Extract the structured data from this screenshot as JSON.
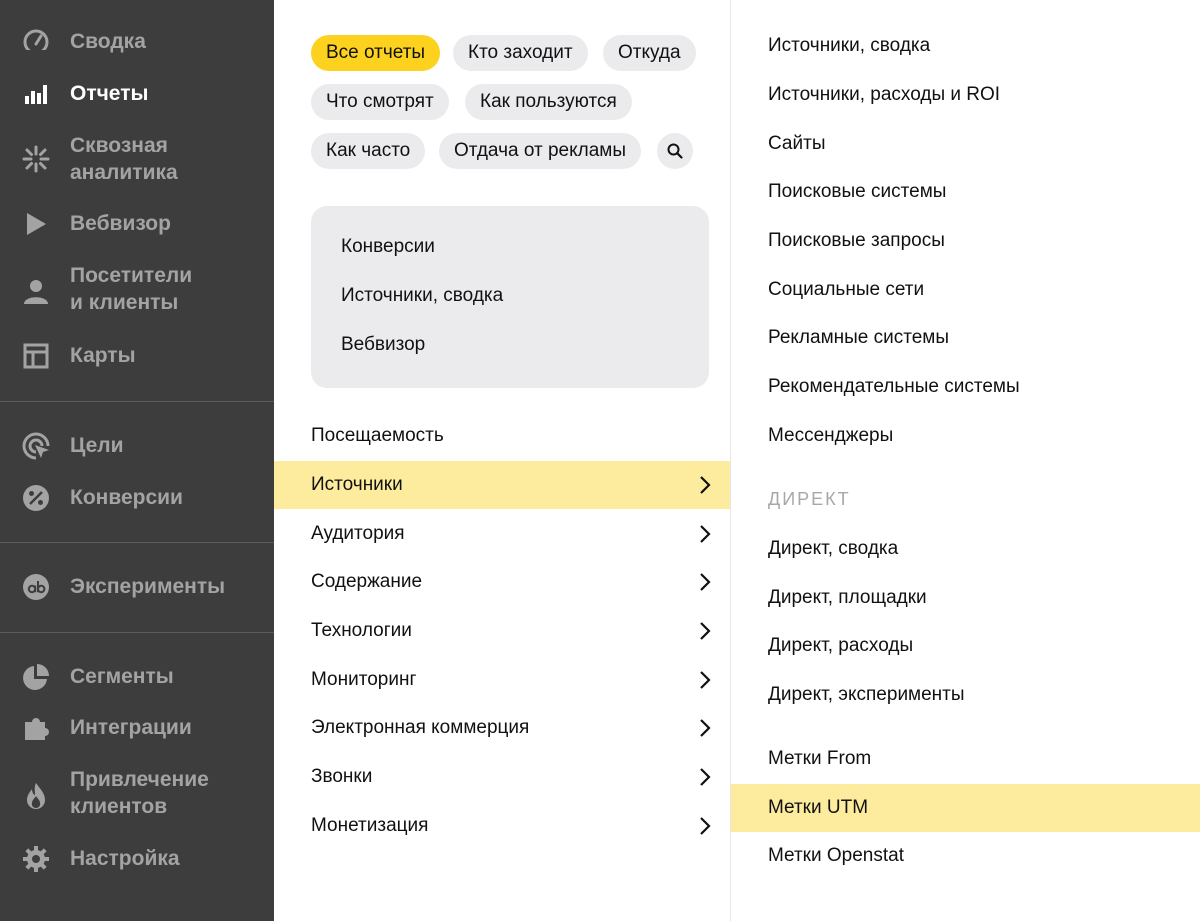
{
  "sidebar": {
    "items": [
      {
        "label": "Сводка",
        "icon": "gauge-icon",
        "active": false
      },
      {
        "label": "Отчеты",
        "icon": "bar-chart-icon",
        "active": true
      },
      {
        "label": "Сквозная\nаналитика",
        "icon": "snowflake-icon",
        "active": false
      },
      {
        "label": "Вебвизор",
        "icon": "play-icon",
        "active": false
      },
      {
        "label": "Посетители\nи клиенты",
        "icon": "user-icon",
        "active": false
      },
      {
        "label": "Карты",
        "icon": "layout-icon",
        "active": false
      },
      {
        "label": "Цели",
        "icon": "target-cursor-icon",
        "active": false
      },
      {
        "label": "Конверсии",
        "icon": "percent-icon",
        "active": false
      },
      {
        "label": "Эксперименты",
        "icon": "ab-icon",
        "active": false
      },
      {
        "label": "Сегменты",
        "icon": "pie-chart-icon",
        "active": false
      },
      {
        "label": "Интеграции",
        "icon": "puzzle-icon",
        "active": false
      },
      {
        "label": "Привлечение\nклиентов",
        "icon": "flame-icon",
        "active": false
      },
      {
        "label": "Настройка",
        "icon": "gear-icon",
        "active": false
      }
    ]
  },
  "filters": {
    "chips": [
      "Все отчеты",
      "Кто заходит",
      "Откуда",
      "Что смотрят",
      "Как пользуются",
      "Как часто",
      "Отдача от рекламы"
    ],
    "active_chip": "Все отчеты",
    "search_icon": "search-icon"
  },
  "favorites": [
    "Конверсии",
    "Источники, сводка",
    "Вебвизор"
  ],
  "categories": [
    {
      "label": "Посещаемость",
      "has_submenu": false
    },
    {
      "label": "Источники",
      "has_submenu": true,
      "selected": true
    },
    {
      "label": "Аудитория",
      "has_submenu": true
    },
    {
      "label": "Содержание",
      "has_submenu": true
    },
    {
      "label": "Технологии",
      "has_submenu": true
    },
    {
      "label": "Мониторинг",
      "has_submenu": true
    },
    {
      "label": "Электронная коммерция",
      "has_submenu": true
    },
    {
      "label": "Звонки",
      "has_submenu": true
    },
    {
      "label": "Монетизация",
      "has_submenu": true
    }
  ],
  "reports": {
    "general": [
      "Источники, сводка",
      "Источники, расходы и ROI",
      "Сайты",
      "Поисковые системы",
      "Поисковые запросы",
      "Социальные сети",
      "Рекламные системы",
      "Рекомендательные системы",
      "Мессенджеры"
    ],
    "direct_header": "ДИРЕКТ",
    "direct": [
      "Директ, сводка",
      "Директ, площадки",
      "Директ, расходы",
      "Директ, эксперименты"
    ],
    "tags": [
      "Метки From",
      "Метки UTM",
      "Метки Openstat"
    ],
    "selected": "Метки UTM"
  },
  "colors": {
    "sidebar_bg": "#3d3d3d",
    "accent_yellow": "#fdd21e",
    "highlight": "#feec9e",
    "chip_bg": "#ebebed"
  }
}
